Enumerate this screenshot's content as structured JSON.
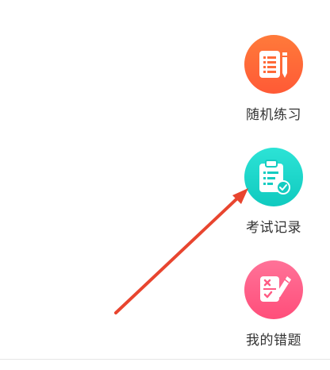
{
  "menu": {
    "items": [
      {
        "label": "随机练习",
        "icon": "notebook-pencil-icon",
        "color_start": "#ff8a3d",
        "color_end": "#ff5a3a"
      },
      {
        "label": "考试记录",
        "icon": "clipboard-check-icon",
        "color_start": "#27e0d3",
        "color_end": "#11cbc0"
      },
      {
        "label": "我的错题",
        "icon": "mistake-pencil-icon",
        "color_start": "#ff6f95",
        "color_end": "#ff4f7b"
      }
    ]
  },
  "annotation": {
    "arrow_color": "#e8452f"
  }
}
